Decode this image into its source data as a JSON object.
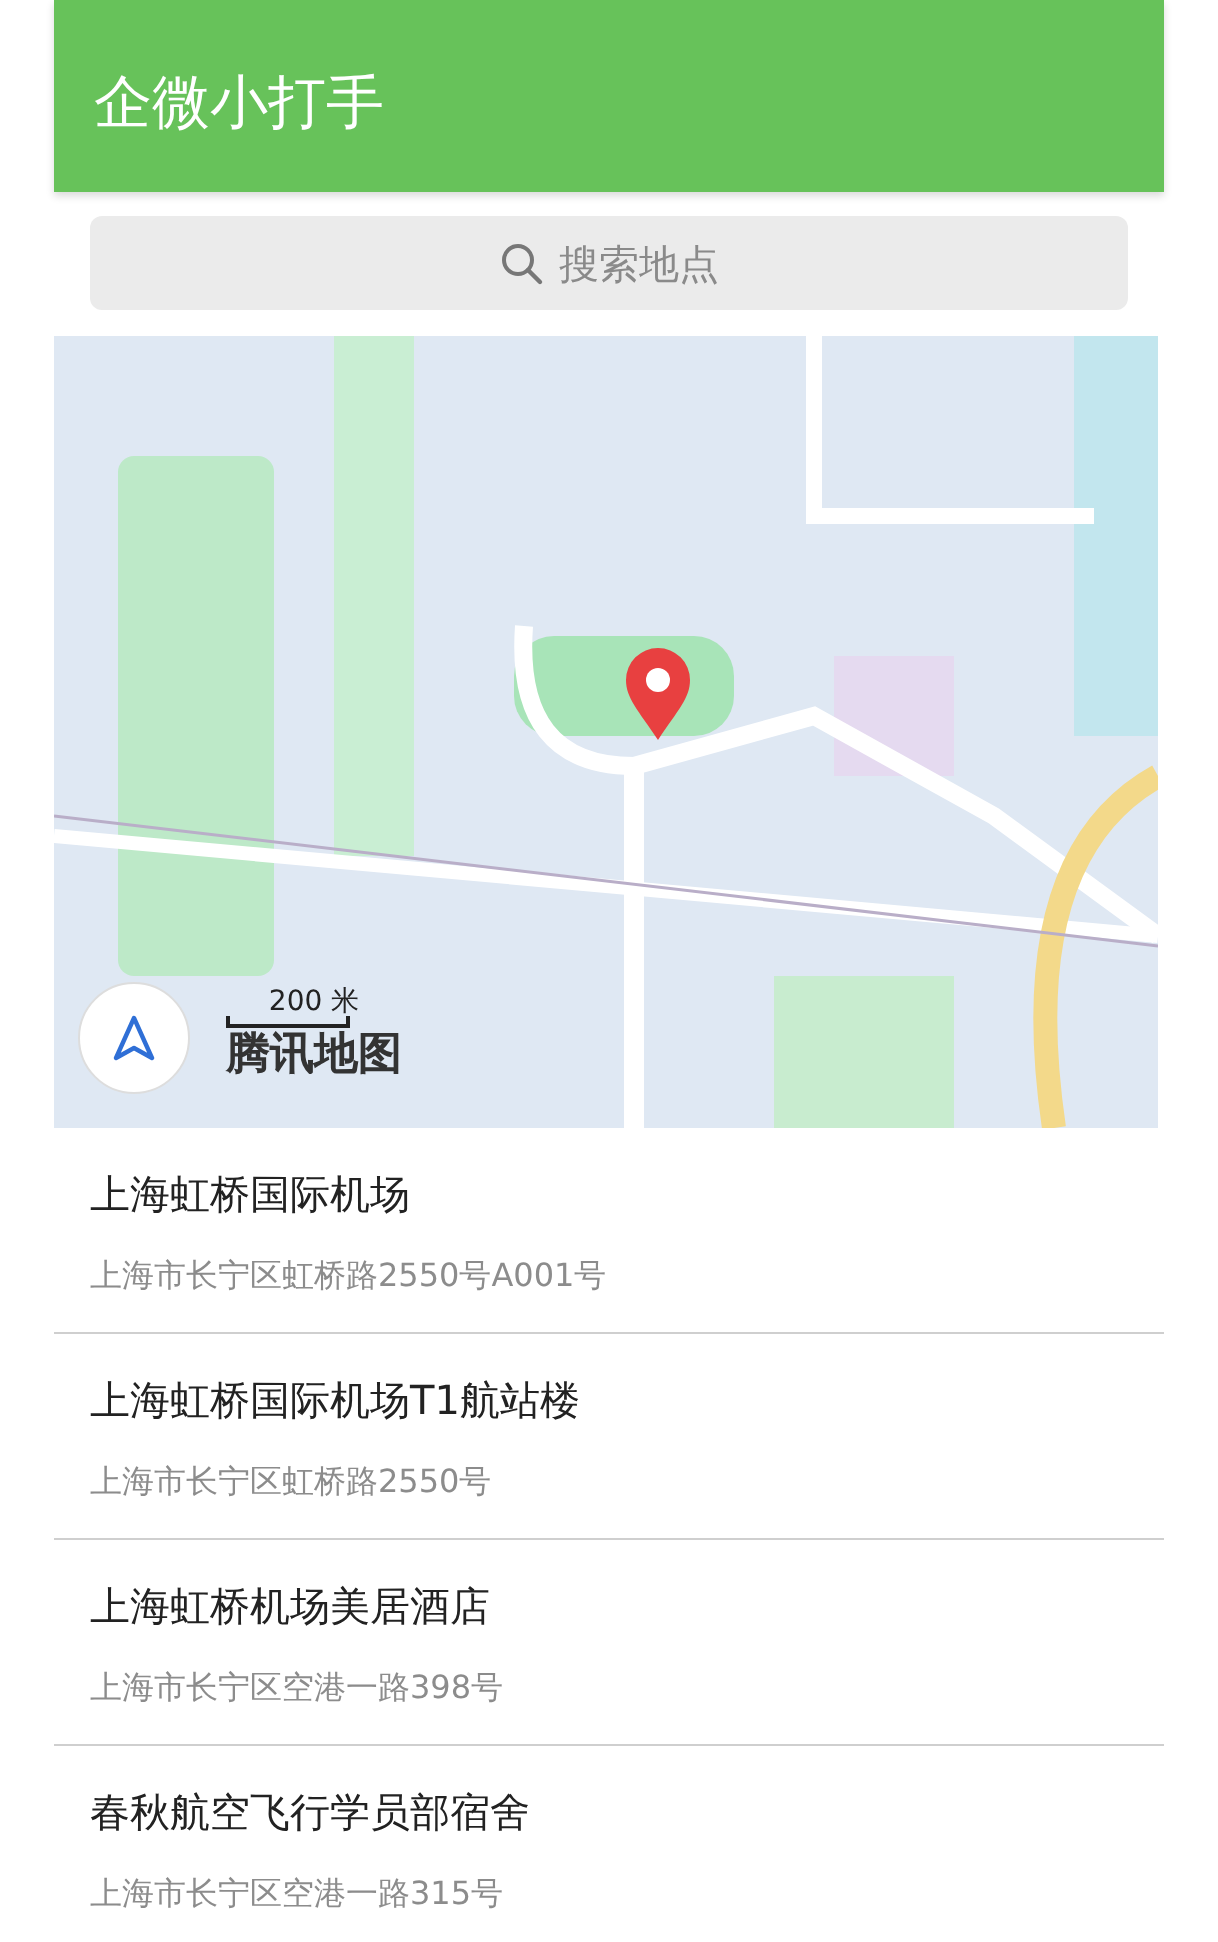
{
  "header": {
    "title": "企微小打手"
  },
  "search": {
    "placeholder": "搜索地点"
  },
  "map": {
    "kind": "picture",
    "scale": "200 米",
    "attribution": "腾讯地图"
  },
  "places": [
    {
      "name": "上海虹桥国际机场",
      "address": "上海市长宁区虹桥路2550号A001号"
    },
    {
      "name": "上海虹桥国际机场T1航站楼",
      "address": "上海市长宁区虹桥路2550号"
    },
    {
      "name": "上海虹桥机场美居酒店",
      "address": "上海市长宁区空港一路398号"
    },
    {
      "name": "春秋航空飞行学员部宿舍",
      "address": "上海市长宁区空港一路315号"
    }
  ]
}
